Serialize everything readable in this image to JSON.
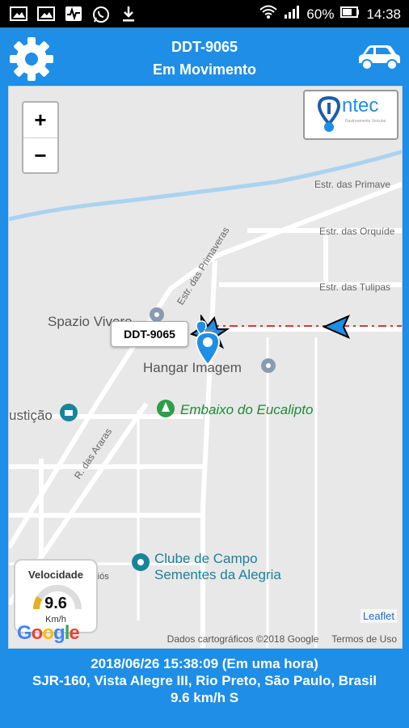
{
  "status_bar": {
    "battery": "60%",
    "time": "14:38"
  },
  "header": {
    "title": "DDT-9065",
    "subtitle": "Em Movimento"
  },
  "map": {
    "zoom_in": "+",
    "zoom_out": "−",
    "logo_text": "ntec",
    "logo_subtext": "Rastreamento Veicular",
    "streets": {
      "primaveras_right": "Estr. das Primave",
      "orquideas": "Estr. das Orquíde",
      "tulipas": "Estr. das Tulipas",
      "primaveras_diag": "Estr. das Primaveras",
      "araras": "R. das Araras"
    },
    "places": {
      "spazio": "Spazio Vivere",
      "hangar": "Hangar Imagem",
      "embaixo": "Embaixo do Eucalipto",
      "justica": "ustição",
      "clube_line1": "Clube de Campo",
      "clube_line2": "Sementes da Alegria",
      "rios": "riós"
    },
    "tooltip": "DDT-9065",
    "speed": {
      "label": "Velocidade",
      "value": "9.6",
      "unit": "Km/h"
    },
    "google": "Google",
    "leaflet": "Leaflet",
    "attribution": "Dados cartográficos ©2018 Google",
    "terms": "Termos de Uso"
  },
  "footer": {
    "datetime": "2018/06/26 15:38:09 (Em uma hora)",
    "address": "SJR-160, Vista Alegre III, Rio Preto, São Paulo, Brasil",
    "speed": "9.6 km/h S"
  }
}
